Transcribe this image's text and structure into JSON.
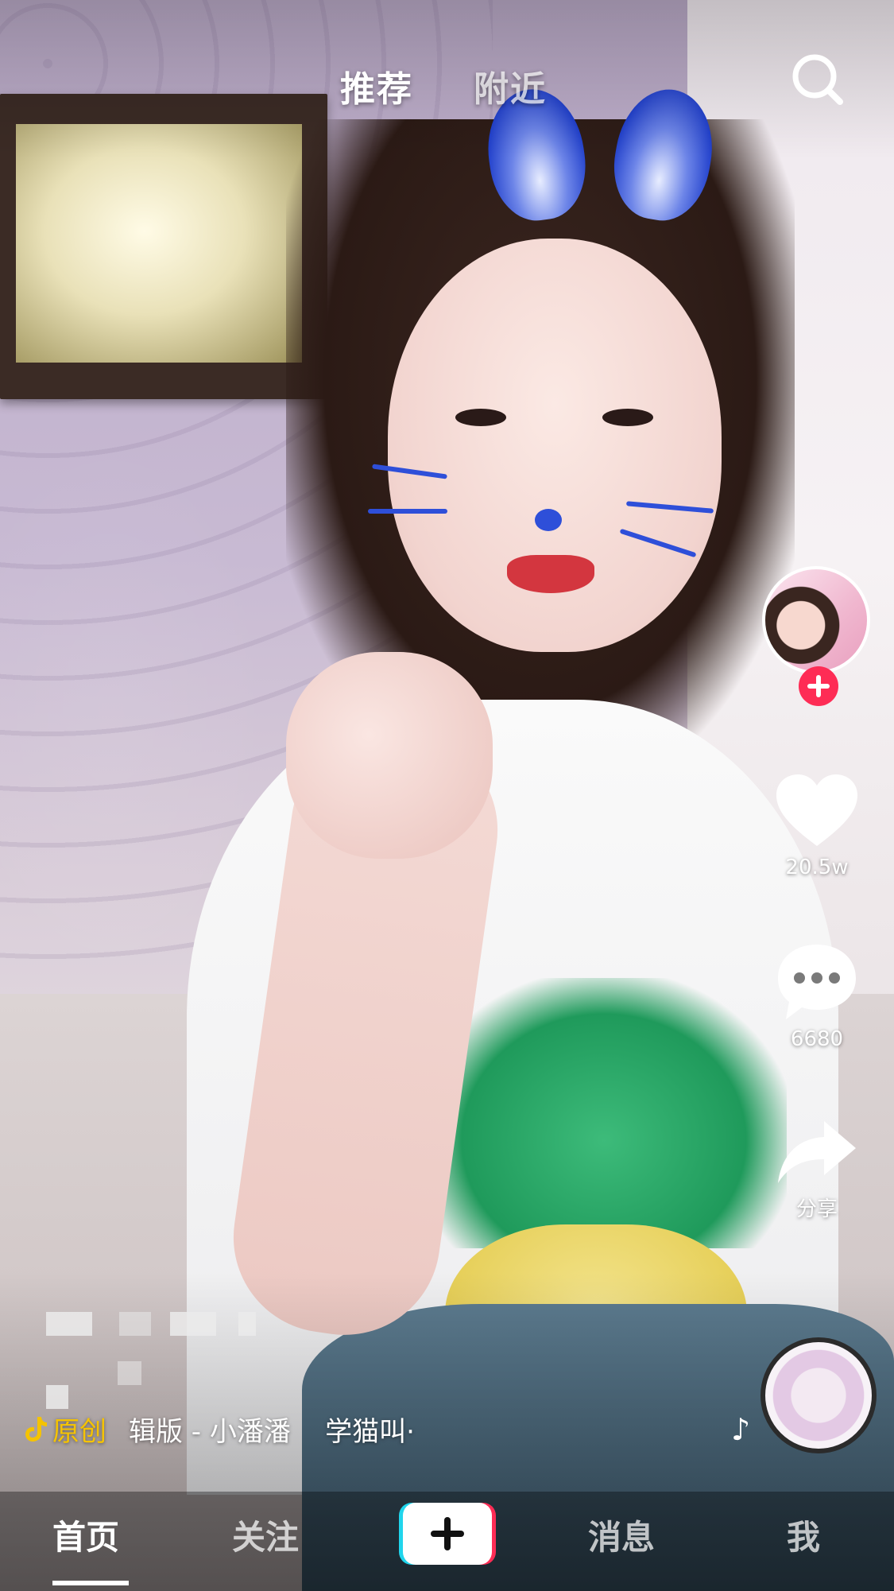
{
  "top_tabs": {
    "recommend": "推荐",
    "nearby": "附近"
  },
  "search": {
    "icon": "search-icon"
  },
  "creator": {
    "follow_icon": "plus-icon",
    "follow_color": "#fe2c55"
  },
  "actions": {
    "like_count": "20.5w",
    "comment_count": "6680",
    "share_label": "分享"
  },
  "music": {
    "badge": "原创",
    "title": "辑版 - 小潘潘    学猫叫·",
    "note_icon": "♪"
  },
  "bottom_nav": {
    "home": "首页",
    "follow": "关注",
    "create": "+",
    "messages": "消息",
    "me": "我"
  },
  "colors": {
    "accent": "#fe2c55",
    "badge": "#f5c300",
    "create_left": "#20d5ec",
    "create_right": "#fe2c55"
  }
}
